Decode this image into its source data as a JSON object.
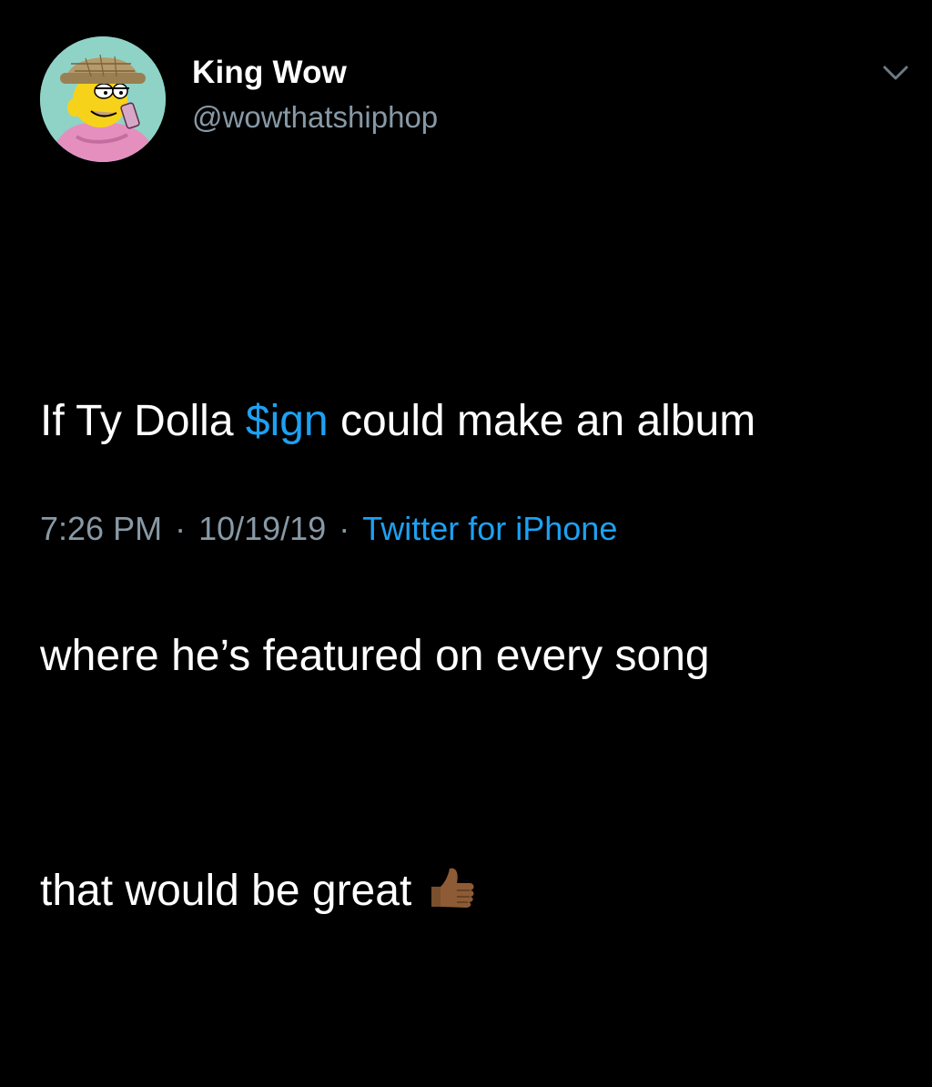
{
  "user": {
    "display_name": "King Wow",
    "handle": "@wowthatshiphop"
  },
  "tweet": {
    "line1_before": "If Ty Dolla ",
    "mention": "$ign",
    "line1_after": " could make an album",
    "line2": "where he’s featured on every song",
    "line3": "that would be great",
    "emoji": "thumbs-up-icon (medium-dark skin tone)"
  },
  "meta": {
    "time": "7:26 PM",
    "separator": "·",
    "date": "10/19/19",
    "source": "Twitter for iPhone"
  },
  "colors": {
    "background": "#000000",
    "text": "#ffffff",
    "secondary": "#8899a6",
    "link": "#1da1f2"
  },
  "icons": {
    "caret": "chevron-down-icon",
    "avatar": "avatar"
  }
}
